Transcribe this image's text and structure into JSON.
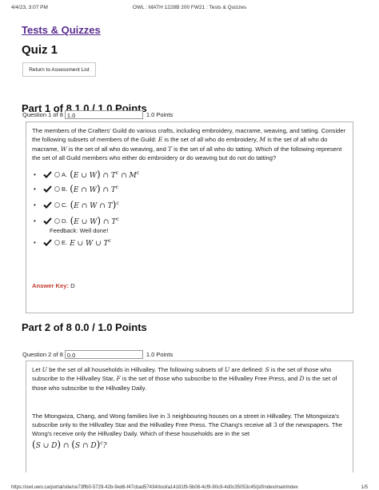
{
  "print_header": {
    "datetime": "4/4/23, 3:07 PM",
    "title": "OWL : MATH 1228B 200 FW21 : Tests & Quizzes"
  },
  "nav": {
    "tests_quizzes_link": "Tests & Quizzes"
  },
  "quiz_title": "Quiz 1",
  "return_button": "Return to Assessment List",
  "part1": {
    "title": "Part 1 of 8 1.0 / 1.0 Points",
    "question_label": "Question 1 of 8",
    "score_value": "1.0",
    "points_suffix": "1.0 Points",
    "text": {
      "s1": "The members of the Crafters' Guild do various crafts, including embroidery, macrame, weaving, and tatting. Consider the following subsets of members of the Guild: ",
      "s2": " is the set of all who do embroidery, ",
      "s3": " is the set of all who do macrame, ",
      "s4": " is the set of all who do weaving, and ",
      "s5": " is the set of all who do tatting. Which of the following represent the set of all Guild members who either do embroidery or do weaving but do not do tatting?"
    },
    "options": [
      {
        "label": "A."
      },
      {
        "label": "B."
      },
      {
        "label": "C."
      },
      {
        "label": "D."
      },
      {
        "label": "E."
      }
    ],
    "feedback": "Feedback: Well done!",
    "answer_key_label": "Answer Key:",
    "answer_key_value": "D"
  },
  "part2": {
    "title": "Part 2 of 8 0.0 / 1.0 Points",
    "question_label": "Question 2 of 8",
    "score_value": "0.0",
    "points_suffix": "1.0 Points",
    "text": {
      "s1": "Let ",
      "s2": " be the set of all households in Hillvalley. The following subsets of ",
      "s3": " are defined: ",
      "s4": " is the set of those who subscribe to the Hillvalley Star, ",
      "s5": " is the set of those who subscribe to the Hillvalley Free Press, and ",
      "s6": " is the set of those who subscribe to the Hillvalley Daily.",
      "p2a": "The Mtongwiza, Chang, and Wong families live in ",
      "p2b": " neighbouring houses on a street in Hillvalley. The Mtongwiza's subscribe only to the Hillvalley Star and the Hillvalley Free Press. The Chang's receive all ",
      "p2c": " of the newspapers. The Wong's receive only the Hillvalley Daily. Which of these households are in the set"
    }
  },
  "print_footer": {
    "url": "https://owl.uwo.ca/portal/site/ce73ffb0-5729-42b-9ed6-f47cbad57434/tool/a14181f9-5b08-4cf9-90c9-4d0c35053c45/jsf/index/mainIndex",
    "page": "1/5"
  }
}
